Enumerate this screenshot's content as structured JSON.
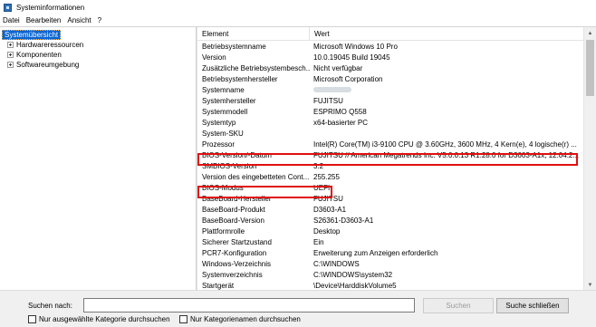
{
  "window": {
    "title": "Systeminformationen",
    "icon": "system-info-icon"
  },
  "menubar": [
    "Datei",
    "Bearbeiten",
    "Ansicht",
    "?"
  ],
  "tree": {
    "root": "Systemübersicht",
    "items": [
      "Hardwareressourcen",
      "Komponenten",
      "Softwareumgebung"
    ]
  },
  "table": {
    "columns": [
      "Element",
      "Wert"
    ],
    "rows": [
      {
        "element": "Betriebsystemname",
        "value": "Microsoft Windows 10 Pro"
      },
      {
        "element": "Version",
        "value": "10.0.19045 Build 19045"
      },
      {
        "element": "Zusätzliche Betriebsystembesch...",
        "value": "Nicht verfügbar"
      },
      {
        "element": "Betriebsystemhersteller",
        "value": "Microsoft Corporation"
      },
      {
        "element": "Systemname",
        "value": ""
      },
      {
        "element": "Systemhersteller",
        "value": "FUJITSU"
      },
      {
        "element": "Systemmodell",
        "value": "ESPRIMO Q558"
      },
      {
        "element": "Systemtyp",
        "value": "x64-basierter PC"
      },
      {
        "element": "System-SKU",
        "value": ""
      },
      {
        "element": "Prozessor",
        "value": "Intel(R) Core(TM) i3-9100 CPU @ 3.60GHz, 3600 MHz, 4 Kern(e), 4 logische(r) ..."
      },
      {
        "element": "BIOS-Version/-Datum",
        "value": "FUJITSU // American Megatrends Inc. V5.0.0.13 R1.28.0 for D3603-A1x, 12.04.2..."
      },
      {
        "element": "SMBIOS-Version",
        "value": "3.2"
      },
      {
        "element": "Version des eingebetteten Cont...",
        "value": "255.255"
      },
      {
        "element": "BIOS-Modus",
        "value": "UEFI"
      },
      {
        "element": "BaseBoard-Hersteller",
        "value": "FUJITSU"
      },
      {
        "element": "BaseBoard-Produkt",
        "value": "D3603-A1"
      },
      {
        "element": "BaseBoard-Version",
        "value": "S26361-D3603-A1"
      },
      {
        "element": "Plattformrolle",
        "value": "Desktop"
      },
      {
        "element": "Sicherer Startzustand",
        "value": "Ein"
      },
      {
        "element": "PCR7-Konfiguration",
        "value": "Erweiterung zum Anzeigen erforderlich"
      },
      {
        "element": "Windows-Verzeichnis",
        "value": "C:\\WINDOWS"
      },
      {
        "element": "Systemverzeichnis",
        "value": "C:\\WINDOWS\\system32"
      },
      {
        "element": "Startgerät",
        "value": "\\Device\\HarddiskVolume5"
      }
    ]
  },
  "search": {
    "label": "Suchen nach:",
    "value": "",
    "search_button": "Suchen",
    "close_button": "Suche schließen",
    "option_selected_category": "Nur ausgewählte Kategorie durchsuchen",
    "option_category_names": "Nur Kategorienamen durchsuchen"
  },
  "colors": {
    "selection": "#0a64d2",
    "highlight_box": "#e01010"
  }
}
